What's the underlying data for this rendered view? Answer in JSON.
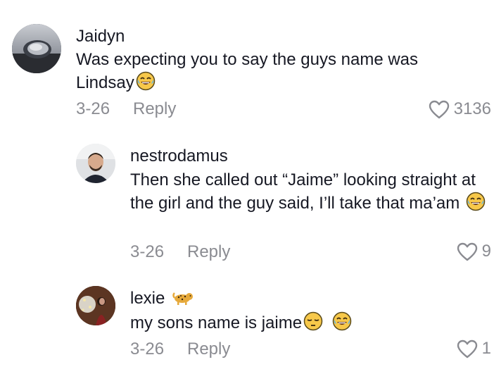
{
  "comments": [
    {
      "username": "Jaidyn",
      "text": "Was expecting you to say the guys name was Lindsay",
      "emoji_after": "joy-tears-emoji",
      "date": "3-26",
      "reply_label": "Reply",
      "likes": "3136"
    },
    {
      "username": "nestrodamus",
      "text": "Then she called out “Jaime” looking straight at the girl and the guy said, I’ll take that ma’am",
      "emoji_after": "joy-tears-emoji",
      "date": "3-26",
      "reply_label": "Reply",
      "likes": "9"
    },
    {
      "username": "lexie",
      "username_icon": "leopard-emoji",
      "text": "my sons name is jaime",
      "emoji_after": [
        "pensive-emoji",
        "joy-tears-emoji"
      ],
      "date": "3-26",
      "reply_label": "Reply",
      "likes": "1"
    }
  ],
  "colors": {
    "primary_text": "#161823",
    "secondary_text": "#8a8b91"
  },
  "icons": {
    "like": "heart-outline-icon"
  }
}
